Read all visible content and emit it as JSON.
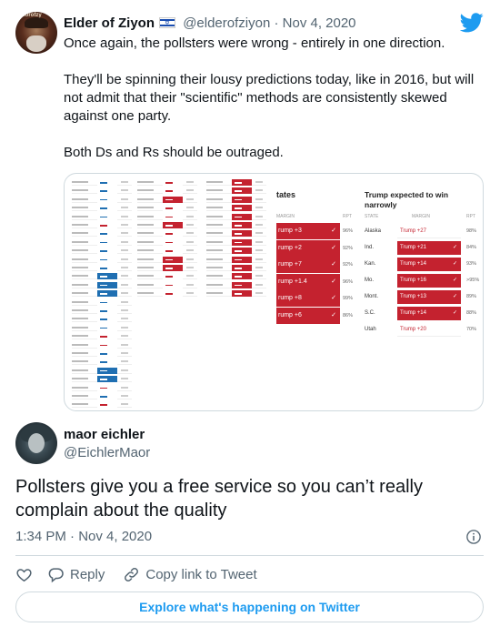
{
  "quoted": {
    "name": "Elder of Ziyon",
    "handle": "@elderofziyon",
    "separator": "·",
    "date": "Nov 4, 2020",
    "avatar_caption": "eldorofzy",
    "text": [
      "Once again, the pollsters were wrong - entirely in one direction.",
      "They'll be spinning their lousy predictions today, like in 2016, but will not admit that their \"scientific\" methods are consistently skewed against one party.",
      "Both Ds and Rs should be outraged."
    ],
    "media": {
      "left_title": "tates",
      "left_headers": [
        "MARGIN",
        "RPT"
      ],
      "left_rows": [
        {
          "margin": "rump +3",
          "pct": "96%"
        },
        {
          "margin": "rump +2",
          "pct": "92%"
        },
        {
          "margin": "rump +7",
          "pct": "92%"
        },
        {
          "margin": "rump +1.4",
          "pct": "96%"
        },
        {
          "margin": "rump +8",
          "pct": "99%"
        },
        {
          "margin": "rump +6",
          "pct": "86%"
        }
      ],
      "right_title": "Trump expected to win narrowly",
      "right_headers": [
        "STATE",
        "MARGIN",
        "RPT"
      ],
      "right_rows": [
        {
          "state": "Alaska",
          "margin": "Trump +27",
          "pct": "98%"
        },
        {
          "state": "Ind.",
          "margin": "Trump +21",
          "pct": "84%"
        },
        {
          "state": "Kan.",
          "margin": "Trump +14",
          "pct": "93%"
        },
        {
          "state": "Mo.",
          "margin": "Trump +16",
          "pct": ">95%"
        },
        {
          "state": "Mont.",
          "margin": "Trump +13",
          "pct": "89%"
        },
        {
          "state": "S.C.",
          "margin": "Trump +14",
          "pct": "88%"
        },
        {
          "state": "Utah",
          "margin": "Trump +20",
          "pct": "70%"
        }
      ]
    }
  },
  "reply": {
    "name": "maor eichler",
    "handle": "@EichlerMaor",
    "text": "Pollsters give you a free service so you can’t really complain about the quality",
    "timestamp": "1:34 PM · Nov 4, 2020"
  },
  "actions": {
    "reply_label": "Reply",
    "copy_label": "Copy link to Tweet"
  },
  "explore_label": "Explore what's happening on Twitter",
  "colors": {
    "accent": "#1d9bf0",
    "trump_red": "#c4222f",
    "biden_blue": "#1f6fb2"
  }
}
